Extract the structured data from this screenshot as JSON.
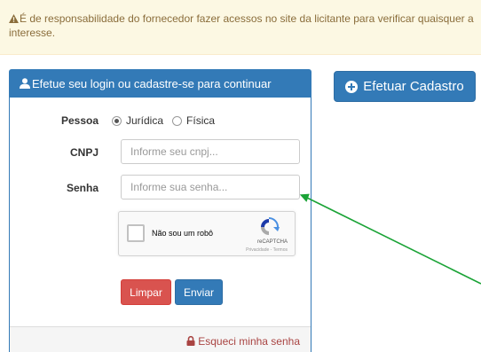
{
  "alert": {
    "line1": "É de responsabilidade do fornecedor fazer acessos no site da licitante para verificar quaisquer a",
    "line2": "interesse.",
    "icon": "warning-icon"
  },
  "login_panel": {
    "heading": "Efetue seu login ou cadastre-se para continuar",
    "heading_icon": "user-icon",
    "pessoa_label": "Pessoa",
    "pessoa_options": [
      "Jurídica",
      "Física"
    ],
    "pessoa_selected": "Jurídica",
    "cnpj_label": "CNPJ",
    "cnpj_placeholder": "Informe seu cnpj...",
    "senha_label": "Senha",
    "senha_placeholder": "Informe sua senha...",
    "recaptcha": {
      "label": "Não sou um robô",
      "brand": "reCAPTCHA",
      "terms": "Privacidade - Termos"
    },
    "clear_label": "Limpar",
    "submit_label": "Enviar",
    "forgot_label": "Esqueci minha senha"
  },
  "cadastro_button": {
    "label": "Efetuar Cadastro",
    "icon": "plus-circle-icon"
  },
  "colors": {
    "primary": "#337ab7",
    "danger": "#d9534f",
    "warning_bg": "#fcf8e3",
    "warning_text": "#8a6d3b",
    "annotation_arrow": "#1aa336"
  }
}
